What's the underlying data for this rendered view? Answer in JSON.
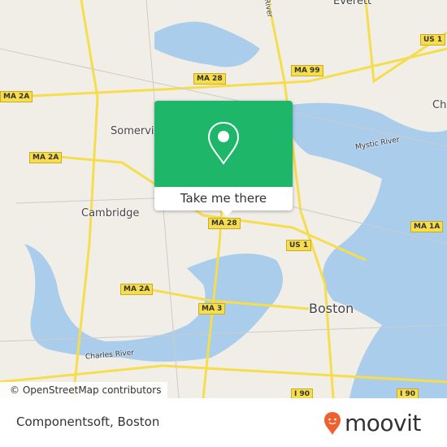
{
  "map": {
    "places": {
      "everett": "Everett",
      "somerville": "Somervi",
      "chelsea": "Ch",
      "cambridge": "Cambridge",
      "boston": "Boston",
      "mystic_river": "Mystic River",
      "charles_river": "Charles River",
      "river_top": "River"
    },
    "shields": [
      "US 1",
      "MA 28",
      "MA 99",
      "MA 2A",
      "MA 2A",
      "MA 28",
      "US 1",
      "MA 1A",
      "MA 2A",
      "MA 3",
      "I 90",
      "I 90"
    ],
    "attribution": "© OpenStreetMap contributors",
    "colors": {
      "land": "#f1eee8",
      "water": "#aacdec",
      "road": "#f6dd4d",
      "popup": "#1eb76a",
      "brand": "#f0602f"
    }
  },
  "popup": {
    "cta_label": "Take me there",
    "icon": "map-pin-icon"
  },
  "footer": {
    "place_name": "Componentsoft, Boston",
    "logo_text": "moovit"
  }
}
